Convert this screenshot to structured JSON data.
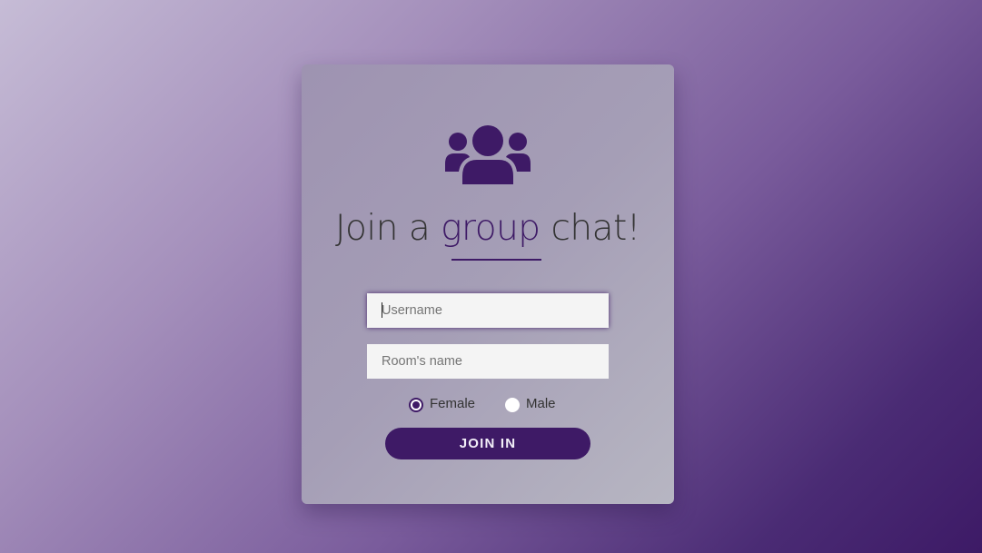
{
  "colors": {
    "accent": "#3e1a66",
    "text": "#333333",
    "input_bg": "#f4f4f4"
  },
  "header": {
    "icon": "users-group-icon",
    "title_prefix": "Join a ",
    "title_highlight": "group",
    "title_suffix": " chat!"
  },
  "form": {
    "username": {
      "placeholder": "Username",
      "value": ""
    },
    "room": {
      "placeholder": "Room's name",
      "value": ""
    },
    "gender": {
      "options": [
        {
          "label": "Female",
          "checked": true
        },
        {
          "label": "Male",
          "checked": false
        }
      ]
    },
    "submit_label": "JOIN IN"
  }
}
